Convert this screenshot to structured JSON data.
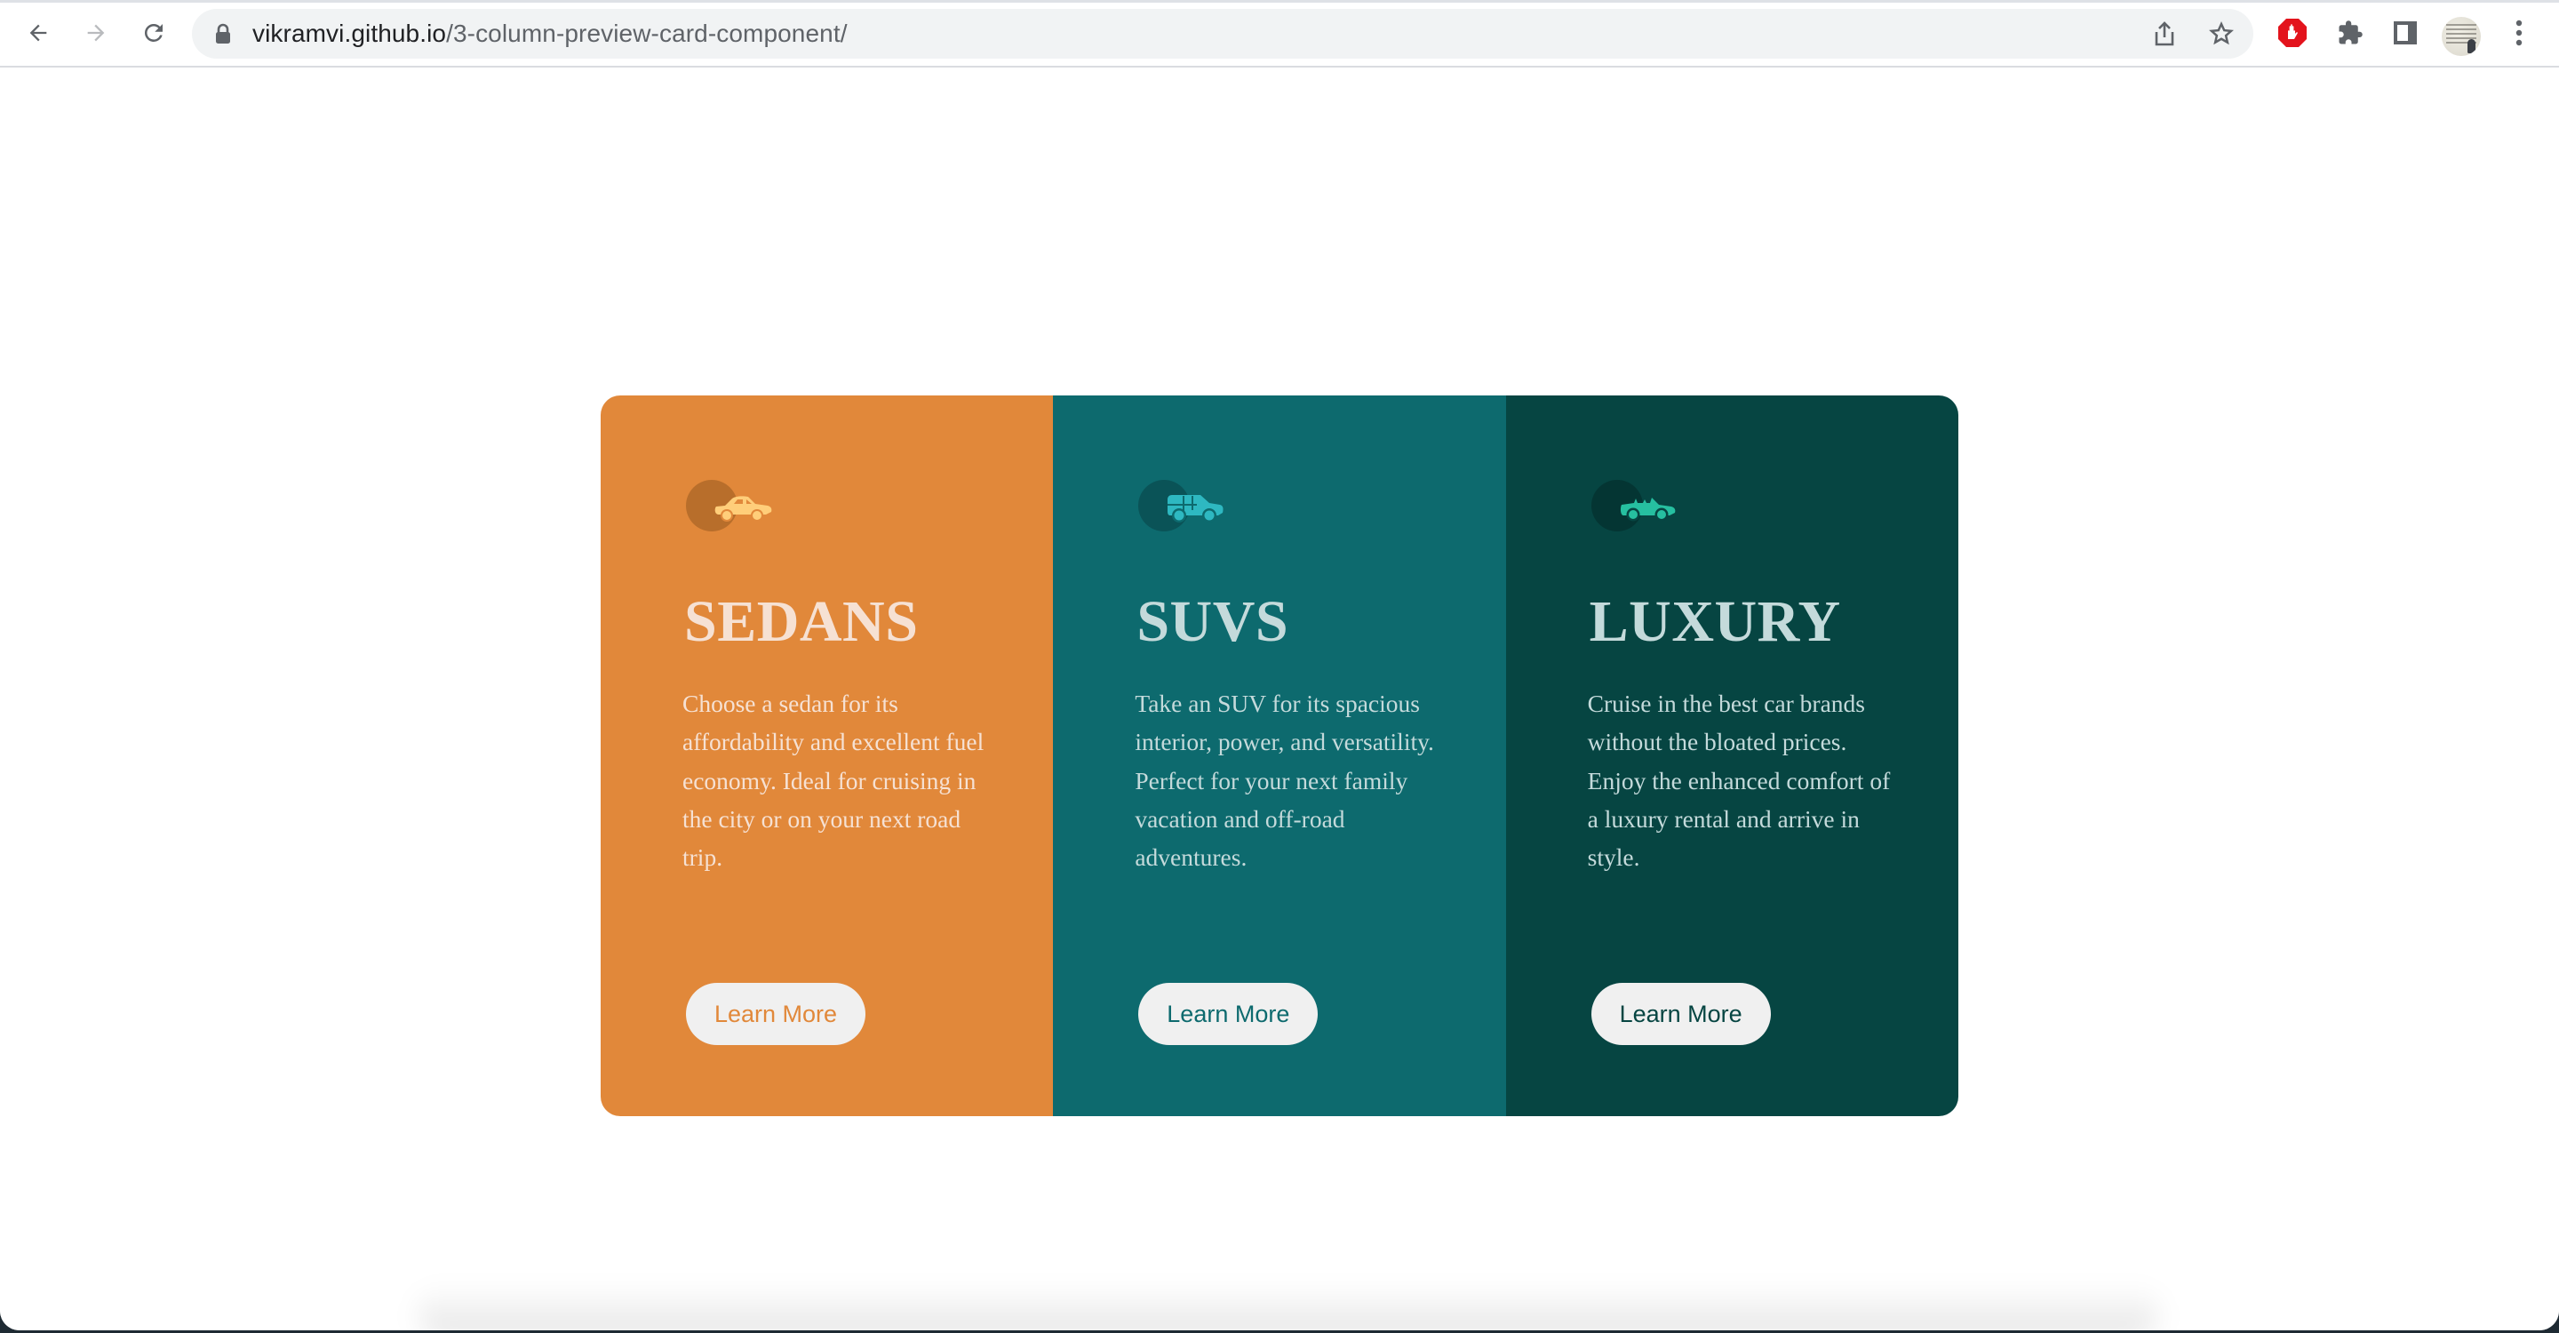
{
  "browser": {
    "url_domain": "vikramvi.github.io",
    "url_path": "/3-column-preview-card-component/",
    "icons": {
      "back": "arrow-left-icon",
      "forward": "arrow-right-icon",
      "reload": "reload-icon",
      "lock": "lock-icon",
      "share": "share-icon",
      "bookmark": "star-icon",
      "adblock": "adblock-hand-icon",
      "extensions": "puzzle-icon",
      "side_panel": "side-panel-icon",
      "profile": "avatar",
      "menu": "kebab-menu-icon"
    }
  },
  "colors": {
    "sedan_bg": "#e1883a",
    "suv_bg": "#0d6a6e",
    "luxury_bg": "#064542",
    "button_bg": "#f0f0f0",
    "heading_light": "#f6e1d3",
    "heading_teal": "#c4dadb"
  },
  "cards": [
    {
      "icon": "sedan-car-icon",
      "title": "SEDANS",
      "description": "Choose a sedan for its affordability and excellent fuel economy. Ideal for cruising in the city or on your next road trip.",
      "button_label": "Learn More"
    },
    {
      "icon": "suv-car-icon",
      "title": "SUVS",
      "description": "Take an SUV for its spacious interior, power, and versatility. Perfect for your next family vacation and off-road adventures.",
      "button_label": "Learn More"
    },
    {
      "icon": "luxury-car-icon",
      "title": "LUXURY",
      "description": "Cruise in the best car brands without the bloated prices. Enjoy the enhanced comfort of a luxury rental and arrive in style.",
      "button_label": "Learn More"
    }
  ]
}
